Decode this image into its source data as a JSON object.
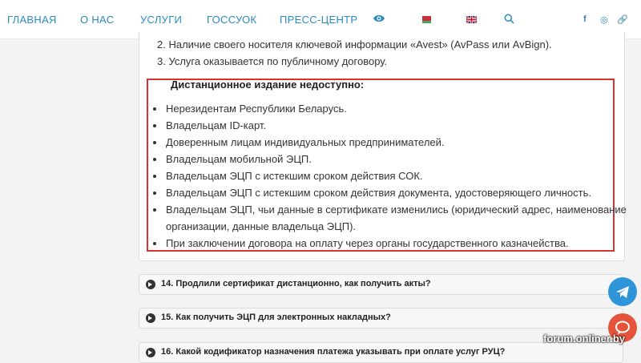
{
  "nav": {
    "items": [
      "ГЛАВНАЯ",
      "О НАС",
      "УСЛУГИ",
      "ГОССУОК",
      "ПРЕСС-ЦЕНТР"
    ],
    "eye_icon": "eye-icon",
    "search_icon": "search-icon",
    "social": [
      "f",
      "◎",
      "🔗"
    ],
    "brand_color": "#2a8bbf"
  },
  "conditions": {
    "item2": "2. Наличие своего носителя ключевой информации «Avest» (AvPass или AvBign).",
    "item3": "3. Услуга оказывается по публичному договору."
  },
  "unavailable": {
    "title": "Дистанционное издание недоступно:",
    "items": [
      "Нерезидентам Республики Беларусь.",
      "Владельцам ID-карт.",
      "Доверенным лицам индивидуальных предпринимателей.",
      "Владельцам мобильной ЭЦП.",
      "Владельцам ЭЦП с истекшим сроком действия СОК.",
      "Владельцам ЭЦП с истекшим сроком действия документа, удостоверяющего личность.",
      "Владельцам ЭЦП, чьи данные в сертификате изменились (юридический адрес, наименование",
      "организации, данные владельца ЭЦП).",
      "При заключении договора на оплату через органы государственного казначейства."
    ],
    "box_color": "#d93232"
  },
  "faq": [
    "14. Продлили сертификат дистанционно, как получить акты?",
    "15. Как получить ЭЦП для электронных накладных?",
    "16. Какой кодификатор назначения платежа указывать при оплате услуг РУЦ?"
  ],
  "watermark": "forum.onliner.by"
}
